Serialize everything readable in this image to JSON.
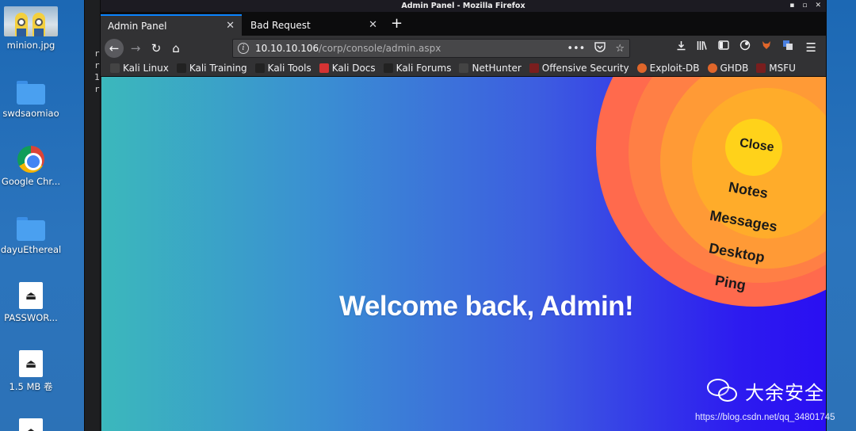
{
  "window": {
    "title": "Admin Panel - Mozilla Firefox",
    "controls": [
      "▪",
      "▫",
      "✕"
    ]
  },
  "desktop": {
    "icons": [
      {
        "label": "minion.jpg"
      },
      {
        "label": "swdsaomiao"
      },
      {
        "label": "Google Chr..."
      },
      {
        "label": "dayuEthereal"
      },
      {
        "label": "PASSWOR..."
      },
      {
        "label": "1.5 MB 卷"
      }
    ]
  },
  "terminal": {
    "lines": [
      "r",
      "r",
      "1",
      "r"
    ]
  },
  "tabs": [
    {
      "title": "Admin Panel",
      "close": "✕"
    },
    {
      "title": "Bad Request",
      "close": "✕"
    }
  ],
  "tab_new": "+",
  "navigation": {
    "back": "←",
    "forward": "→",
    "reload": "↻",
    "home": "⌂"
  },
  "urlbar": {
    "host": "10.10.10.106",
    "path": "/corp/console/admin.aspx",
    "info_icon": "i",
    "more": "•••"
  },
  "bookmarks": [
    {
      "label": "Kali Linux",
      "icon_color": "#444444"
    },
    {
      "label": "Kali Training",
      "icon_color": "#222222"
    },
    {
      "label": "Kali Tools",
      "icon_color": "#222222"
    },
    {
      "label": "Kali Docs",
      "icon_color": "#d43333"
    },
    {
      "label": "Kali Forums",
      "icon_color": "#222222"
    },
    {
      "label": "NetHunter",
      "icon_color": "#444444"
    },
    {
      "label": "Offensive Security",
      "icon_color": "#7a1e1e"
    },
    {
      "label": "Exploit-DB",
      "icon_color": "#e0662a"
    },
    {
      "label": "GHDB",
      "icon_color": "#e0662a"
    },
    {
      "label": "MSFU",
      "icon_color": "#7a1e1e"
    }
  ],
  "page": {
    "welcome": "Welcome back, Admin!",
    "menu": {
      "close": "Close",
      "notes": "Notes",
      "messages": "Messages",
      "desktop": "Desktop",
      "ping": "Ping"
    }
  },
  "watermark": {
    "brand": "大余安全",
    "url": "https://blog.csdn.net/qq_34801745"
  },
  "colors": {
    "accent": "#0a84ff",
    "ring_outer": "#ff6a4d",
    "ring_center": "#ffd21a"
  }
}
